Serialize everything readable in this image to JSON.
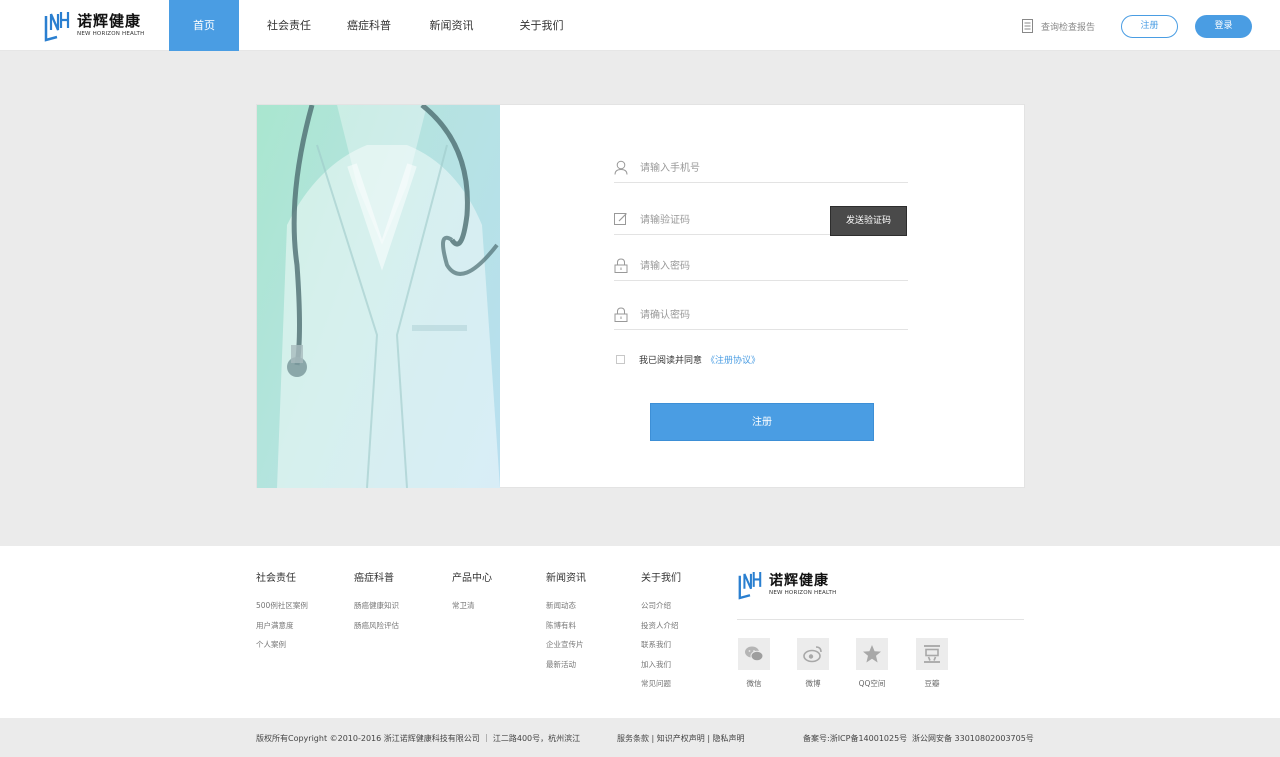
{
  "header": {
    "logo_cn": "诺辉健康",
    "logo_en": "NEW HORIZON HEALTH",
    "nav": [
      {
        "label": "首页",
        "active": true
      },
      {
        "label": "社会责任",
        "active": false
      },
      {
        "label": "癌症科普",
        "active": false
      },
      {
        "label": "新闻资讯",
        "active": false
      },
      {
        "label": "关于我们",
        "active": false
      }
    ],
    "report_link": "查询检查报告",
    "register_label": "注册",
    "login_label": "登录"
  },
  "form": {
    "phone_placeholder": "请输入手机号",
    "code_placeholder": "请输验证码",
    "send_code_label": "发送验证码",
    "password_placeholder": "请输入密码",
    "confirm_placeholder": "请确认密码",
    "agree_text": "我已阅读并同意",
    "agree_link": "《注册协议》",
    "submit_label": "注册"
  },
  "footer": {
    "columns": [
      {
        "title": "社会责任",
        "links": [
          "500例社区案例",
          "用户满意度",
          "个人案例"
        ]
      },
      {
        "title": "癌症科普",
        "links": [
          "肠癌健康知识",
          "肠癌风险评估"
        ]
      },
      {
        "title": "产品中心",
        "links": [
          "常卫清"
        ]
      },
      {
        "title": "新闻资讯",
        "links": [
          "新闻动态",
          "陈博有料",
          "企业宣传片",
          "最新活动"
        ]
      },
      {
        "title": "关于我们",
        "links": [
          "公司介绍",
          "投资人介绍",
          "联系我们",
          "加入我们",
          "常见问题"
        ]
      }
    ],
    "logo_cn": "诺辉健康",
    "logo_en": "NEW HORIZON HEALTH",
    "social": [
      {
        "label": "微信",
        "icon": "wechat-icon"
      },
      {
        "label": "微博",
        "icon": "weibo-icon"
      },
      {
        "label": "QQ空间",
        "icon": "qzone-icon"
      },
      {
        "label": "豆瓣",
        "icon": "douban-icon"
      }
    ]
  },
  "bottom": {
    "copyright": "版权所有Copyright ©2010-2016   浙江诺辉健康科技有限公司  ｜  江二路400号，杭州滨江",
    "legal": "服务条款 | 知识产权声明 | 隐私声明",
    "icp": "备案号:浙ICP备14001025号",
    "police": "浙公网安备 33010802003705号"
  },
  "colors": {
    "accent": "#4a9de3",
    "dark_button": "#4a4a4a",
    "page_bg": "#ebebeb"
  }
}
